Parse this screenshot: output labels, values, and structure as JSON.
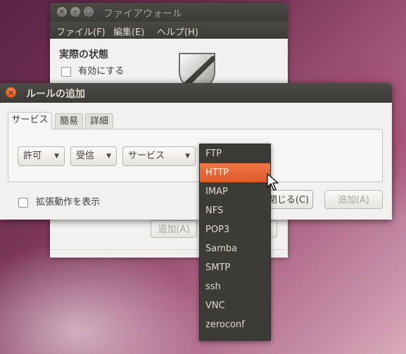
{
  "firewall_window": {
    "title": "ファイアウォール",
    "menu": [
      "ファイル(F)",
      "編集(E)",
      "ヘルプ(H)"
    ],
    "status_heading": "実際の状態",
    "enable_label": "有効にする",
    "enabled": false,
    "add_label": "追加(A)"
  },
  "rule_dialog": {
    "title": "ルールの追加",
    "tabs": [
      "サービス",
      "簡易",
      "詳細"
    ],
    "active_tab": "サービス",
    "policy": "許可",
    "direction": "受信",
    "service": "サービス",
    "expand_label": "拡張動作を表示",
    "expand_checked": false,
    "close_label": "閉じる(C)",
    "add_label": "追加(A)"
  },
  "service_menu": {
    "items": [
      "FTP",
      "HTTP",
      "IMAP",
      "NFS",
      "POP3",
      "Samba",
      "SMTP",
      "ssh",
      "VNC",
      "zeroconf"
    ],
    "highlighted": "HTTP"
  },
  "colors": {
    "accent": "#e0582a",
    "titlebar": "#3c3b37",
    "window_bg": "#f2f1f0"
  }
}
